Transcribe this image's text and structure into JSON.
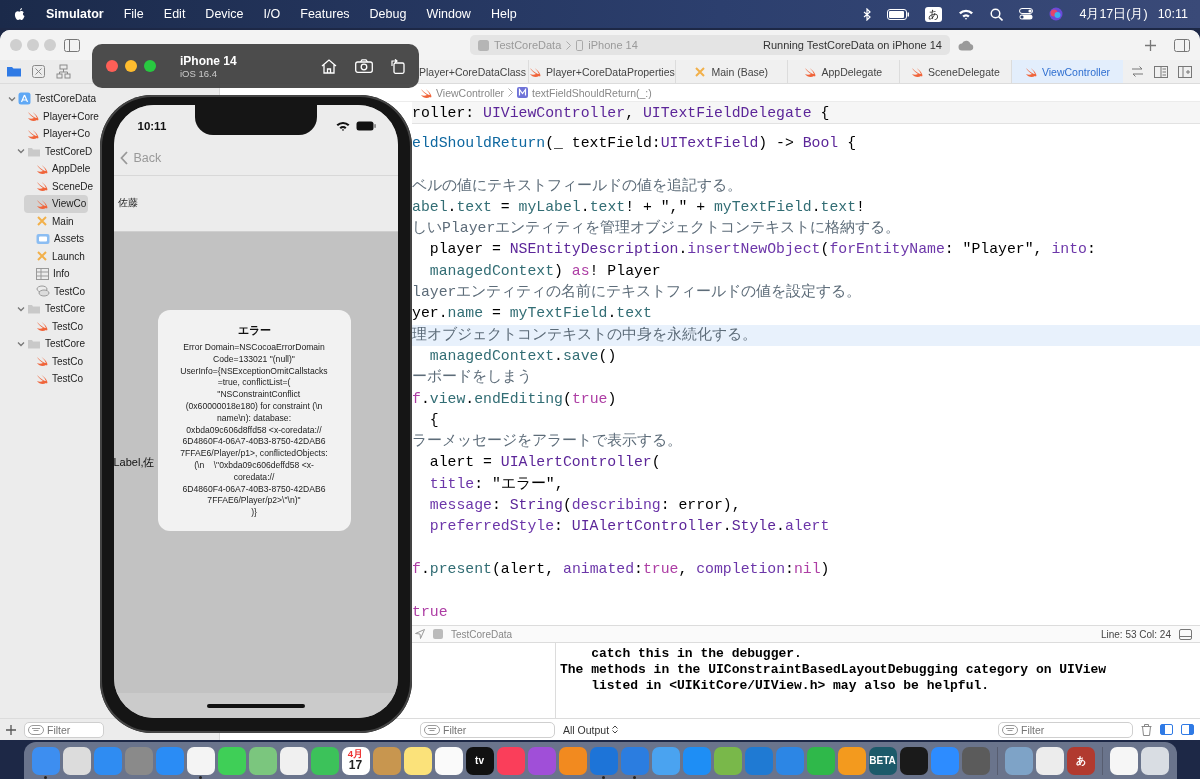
{
  "menu_bar": {
    "app": "Simulator",
    "items": [
      "File",
      "Edit",
      "Device",
      "I/O",
      "Features",
      "Debug",
      "Window",
      "Help"
    ],
    "input_source": "あ",
    "date": "4月17日(月)",
    "time": "10:11"
  },
  "xcode": {
    "activity": {
      "scheme": "TestCoreData",
      "device": "iPhone 14",
      "status": "Running TestCoreData on iPhone 14"
    },
    "navigator_tabs": [
      {
        "selected": true
      },
      {
        "selected": false
      },
      {
        "selected": false
      }
    ],
    "tree": [
      {
        "label": "TestCoreData",
        "kind": "project",
        "expanded": true,
        "selected": false,
        "children": [
          {
            "label": "Player+Core",
            "kind": "swift",
            "selected": false
          },
          {
            "label": "Player+Co",
            "kind": "swift",
            "selected": false
          },
          {
            "label": "TestCoreD",
            "kind": "folder",
            "expanded": true,
            "selected": false,
            "children": [
              {
                "label": "AppDele",
                "kind": "swift",
                "selected": false
              },
              {
                "label": "SceneDe",
                "kind": "swift",
                "selected": false
              },
              {
                "label": "ViewCo",
                "kind": "swift",
                "selected": true
              },
              {
                "label": "Main",
                "kind": "storyboard",
                "selected": false
              },
              {
                "label": "Assets",
                "kind": "assets",
                "selected": false
              },
              {
                "label": "Launch",
                "kind": "storyboard",
                "selected": false
              },
              {
                "label": "Info",
                "kind": "plist",
                "selected": false
              },
              {
                "label": "TestCo",
                "kind": "datamodel",
                "selected": false
              }
            ]
          },
          {
            "label": "TestCore",
            "kind": "folder",
            "expanded": true,
            "selected": false,
            "children": [
              {
                "label": "TestCo",
                "kind": "swift",
                "selected": false
              }
            ]
          },
          {
            "label": "TestCore",
            "kind": "folder",
            "expanded": true,
            "selected": false,
            "children": [
              {
                "label": "TestCo",
                "kind": "swift",
                "selected": false
              },
              {
                "label": "TestCo",
                "kind": "swift",
                "selected": false
              }
            ]
          }
        ]
      }
    ],
    "navigator_filter": {
      "placeholder": "Filter"
    },
    "tabs": [
      {
        "label": "Player+CoreDataClass",
        "selected": false
      },
      {
        "label": "Player+CoreDataProperties",
        "kind": "swift",
        "selected": false
      },
      {
        "label": "Main (Base)",
        "kind": "storyboard",
        "selected": false
      },
      {
        "label": "AppDelegate",
        "kind": "swift",
        "selected": false
      },
      {
        "label": "SceneDelegate",
        "kind": "swift",
        "selected": false
      },
      {
        "label": "ViewController",
        "kind": "swift",
        "selected": true
      }
    ],
    "breadcrumb": [
      {
        "label": "ViewController",
        "kind": "swift"
      },
      {
        "label": "textFieldShouldReturn(_:)",
        "kind": "method"
      }
    ],
    "sticky_header": [
      {
        "text": "roller: ",
        "kind": "plain"
      },
      {
        "text": "UIViewController",
        "kind": "type"
      },
      {
        "text": ", ",
        "kind": "plain"
      },
      {
        "text": "UITextFieldDelegate",
        "kind": "type"
      },
      {
        "text": " {",
        "kind": "plain"
      }
    ],
    "code_lines": [
      {
        "kind": "code",
        "highlighted": false,
        "tokens": [
          {
            "text": "eldShouldReturn",
            "kind": "decl"
          },
          {
            "text": "(_ textField:",
            "kind": "plain"
          },
          {
            "text": "UITextField",
            "kind": "type"
          },
          {
            "text": ") -> ",
            "kind": "plain"
          },
          {
            "text": "Bool",
            "kind": "type"
          },
          {
            "text": " {",
            "kind": "plain"
          }
        ]
      },
      {
        "kind": "blank",
        "highlighted": false
      },
      {
        "kind": "comment",
        "highlighted": false,
        "text": "ベルの値にテキストフィールドの値を追記する。"
      },
      {
        "kind": "code",
        "highlighted": false,
        "tokens": [
          {
            "text": "abel",
            "kind": "member"
          },
          {
            "text": ".",
            "kind": "plain"
          },
          {
            "text": "text",
            "kind": "member"
          },
          {
            "text": " = ",
            "kind": "plain"
          },
          {
            "text": "myLabel",
            "kind": "member"
          },
          {
            "text": ".",
            "kind": "plain"
          },
          {
            "text": "text",
            "kind": "member"
          },
          {
            "text": "! + \",\" + ",
            "kind": "plain"
          },
          {
            "text": "myTextField",
            "kind": "member"
          },
          {
            "text": ".",
            "kind": "plain"
          },
          {
            "text": "text",
            "kind": "member"
          },
          {
            "text": "!",
            "kind": "plain"
          }
        ]
      },
      {
        "kind": "comment",
        "highlighted": false,
        "text": "しいPlayerエンティティを管理オブジェクトコンテキストに格納する。"
      },
      {
        "kind": "code",
        "highlighted": false,
        "tokens": [
          {
            "text": "  player = ",
            "kind": "plain"
          },
          {
            "text": "NSEntityDescription",
            "kind": "type"
          },
          {
            "text": ".",
            "kind": "plain"
          },
          {
            "text": "insertNewObject",
            "kind": "api"
          },
          {
            "text": "(",
            "kind": "plain"
          },
          {
            "text": "forEntityName",
            "kind": "api"
          },
          {
            "text": ": \"Player\", ",
            "kind": "plain"
          },
          {
            "text": "into",
            "kind": "api"
          },
          {
            "text": ":",
            "kind": "plain"
          }
        ]
      },
      {
        "kind": "code",
        "highlighted": false,
        "tokens": [
          {
            "text": "  managedContext",
            "kind": "member"
          },
          {
            "text": ") ",
            "kind": "plain"
          },
          {
            "text": "as",
            "kind": "keyword"
          },
          {
            "text": "! Player",
            "kind": "plain"
          }
        ]
      },
      {
        "kind": "comment",
        "highlighted": false,
        "text": "layerエンティティの名前にテキストフィールドの値を設定する。"
      },
      {
        "kind": "code",
        "highlighted": false,
        "tokens": [
          {
            "text": "yer.",
            "kind": "plain"
          },
          {
            "text": "name",
            "kind": "member"
          },
          {
            "text": " = ",
            "kind": "plain"
          },
          {
            "text": "myTextField",
            "kind": "member"
          },
          {
            "text": ".",
            "kind": "plain"
          },
          {
            "text": "text",
            "kind": "member"
          }
        ]
      },
      {
        "kind": "comment",
        "highlighted": true,
        "text": "理オブジェクトコンテキストの中身を永続化する。"
      },
      {
        "kind": "code",
        "highlighted": false,
        "tokens": [
          {
            "text": "  managedContext",
            "kind": "member"
          },
          {
            "text": ".",
            "kind": "plain"
          },
          {
            "text": "save",
            "kind": "member"
          },
          {
            "text": "()",
            "kind": "plain"
          }
        ]
      },
      {
        "kind": "comment",
        "highlighted": false,
        "text": "ーボードをしまう"
      },
      {
        "kind": "code",
        "highlighted": false,
        "tokens": [
          {
            "text": "f",
            "kind": "keyword"
          },
          {
            "text": ".",
            "kind": "plain"
          },
          {
            "text": "view",
            "kind": "member"
          },
          {
            "text": ".",
            "kind": "plain"
          },
          {
            "text": "endEditing",
            "kind": "member"
          },
          {
            "text": "(",
            "kind": "plain"
          },
          {
            "text": "true",
            "kind": "keyword"
          },
          {
            "text": ")",
            "kind": "plain"
          }
        ]
      },
      {
        "kind": "code",
        "highlighted": false,
        "tokens": [
          {
            "text": "  {",
            "kind": "plain"
          }
        ]
      },
      {
        "kind": "comment",
        "highlighted": false,
        "text": "ラーメッセージをアラートで表示する。"
      },
      {
        "kind": "code",
        "highlighted": false,
        "tokens": [
          {
            "text": "  alert = ",
            "kind": "plain"
          },
          {
            "text": "UIAlertController",
            "kind": "type"
          },
          {
            "text": "(",
            "kind": "plain"
          }
        ]
      },
      {
        "kind": "code",
        "highlighted": false,
        "tokens": [
          {
            "text": "  title",
            "kind": "api"
          },
          {
            "text": ": \"エラー\",",
            "kind": "plain"
          }
        ]
      },
      {
        "kind": "code",
        "highlighted": false,
        "tokens": [
          {
            "text": "  message",
            "kind": "api"
          },
          {
            "text": ": ",
            "kind": "plain"
          },
          {
            "text": "String",
            "kind": "type"
          },
          {
            "text": "(",
            "kind": "plain"
          },
          {
            "text": "describing",
            "kind": "api"
          },
          {
            "text": ": error),",
            "kind": "plain"
          }
        ]
      },
      {
        "kind": "code",
        "highlighted": false,
        "tokens": [
          {
            "text": "  preferredStyle",
            "kind": "api"
          },
          {
            "text": ": ",
            "kind": "plain"
          },
          {
            "text": "UIAlertController",
            "kind": "type"
          },
          {
            "text": ".",
            "kind": "plain"
          },
          {
            "text": "Style",
            "kind": "type"
          },
          {
            "text": ".",
            "kind": "plain"
          },
          {
            "text": "alert",
            "kind": "api"
          }
        ]
      },
      {
        "kind": "blank",
        "highlighted": false
      },
      {
        "kind": "code",
        "highlighted": false,
        "tokens": [
          {
            "text": "f",
            "kind": "keyword"
          },
          {
            "text": ".",
            "kind": "plain"
          },
          {
            "text": "present",
            "kind": "member"
          },
          {
            "text": "(alert, ",
            "kind": "plain"
          },
          {
            "text": "animated",
            "kind": "api"
          },
          {
            "text": ":",
            "kind": "plain"
          },
          {
            "text": "true",
            "kind": "keyword"
          },
          {
            "text": ", ",
            "kind": "plain"
          },
          {
            "text": "completion",
            "kind": "api"
          },
          {
            "text": ":",
            "kind": "plain"
          },
          {
            "text": "nil",
            "kind": "keyword"
          },
          {
            "text": ")",
            "kind": "plain"
          }
        ]
      },
      {
        "kind": "blank",
        "highlighted": false
      },
      {
        "kind": "code",
        "highlighted": false,
        "tokens": [
          {
            "text": "true",
            "kind": "keyword"
          }
        ]
      }
    ],
    "debug_bar": {
      "target": "TestCoreData",
      "position": "Line: 53  Col: 24"
    },
    "console": {
      "output": "    catch this in the debugger.\nThe methods in the UIConstraintBasedLayoutDebugging category on UIView\n    listed in <UIKitCore/UIView.h> may also be helpful."
    },
    "variables_filter": {
      "placeholder": "Filter"
    },
    "output_menu": "All Output",
    "console_filter": {
      "placeholder": "Filter"
    }
  },
  "simulator": {
    "device": "iPhone 14",
    "os": "iOS 16.4",
    "screen": {
      "time": "10:11",
      "back": "Back",
      "cell": "佐藤",
      "label": "Label,佐",
      "alert": {
        "title": "エラー",
        "message": "Error Domain=NSCocoaErrorDomain\nCode=133021 \"(null)\"\nUserInfo={NSExceptionOmitCallstacks\n=true, conflictList=(\n    \"NSConstraintConflict\n(0x60000018e180) for constraint (\\n\nname\\n): database:\n0xbda09c606d8ffd58 <x-coredata://\n6D4860F4-06A7-40B3-8750-42DAB6\n7FFAE6/Player/p1>, conflictedObjects:\n(\\n    \\\"0xbda09c606deffd58 <x-\ncoredata://\n6D4860F4-06A7-40B3-8750-42DAB6\n7FFAE6/Player/p2>\\\"\\n)\"\n)}"
      }
    }
  },
  "dock": [
    {
      "kind": "app",
      "color": "#3d8ef0",
      "running": true
    },
    {
      "kind": "app",
      "color": "#dcdcdc",
      "running": false
    },
    {
      "kind": "app",
      "color": "#2f8cf2",
      "running": false
    },
    {
      "kind": "app",
      "color": "#8a8a8a",
      "running": false
    },
    {
      "kind": "app",
      "color": "#2a8cf5",
      "running": false
    },
    {
      "kind": "app",
      "color": "#f4f4f4",
      "running": true
    },
    {
      "kind": "app",
      "color": "#3fcf57",
      "running": false
    },
    {
      "kind": "app",
      "color": "#7bc67e",
      "running": false
    },
    {
      "kind": "app",
      "color": "#f0f0f0",
      "running": false
    },
    {
      "kind": "app",
      "color": "#3cc25a",
      "running": false
    },
    {
      "kind": "app",
      "color": "#ffffff",
      "running": false,
      "header": "4月",
      "label": "17"
    },
    {
      "kind": "app",
      "color": "#c8964f",
      "running": false
    },
    {
      "kind": "app",
      "color": "#fbe27a",
      "running": false
    },
    {
      "kind": "app",
      "color": "#fafafa",
      "running": false
    },
    {
      "kind": "app",
      "color": "#111111",
      "running": false,
      "label": "tv"
    },
    {
      "kind": "app",
      "color": "#fa3e5a",
      "running": false
    },
    {
      "kind": "app",
      "color": "#a04fd8",
      "running": false
    },
    {
      "kind": "app",
      "color": "#f28a1f",
      "running": false
    },
    {
      "kind": "app",
      "color": "#1d74d8",
      "running": true
    },
    {
      "kind": "app",
      "color": "#2b7de0",
      "running": true
    },
    {
      "kind": "app",
      "color": "#4aa3f0",
      "running": false
    },
    {
      "kind": "app",
      "color": "#1e8ef5",
      "running": false
    },
    {
      "kind": "app",
      "color": "#79b84a",
      "running": false
    },
    {
      "kind": "app",
      "color": "#1f7ad3",
      "running": false
    },
    {
      "kind": "app",
      "color": "#2c86e5",
      "running": false
    },
    {
      "kind": "app",
      "color": "#2fb84a",
      "running": false
    },
    {
      "kind": "app",
      "color": "#f39a1e",
      "running": false
    },
    {
      "kind": "app",
      "color": "#1c5a6a",
      "running": false,
      "label": "BETA"
    },
    {
      "kind": "app",
      "color": "#1a1a1a",
      "running": false
    },
    {
      "kind": "app",
      "color": "#2d8cff",
      "running": false
    },
    {
      "kind": "app",
      "color": "#5b5b5b",
      "running": false
    },
    {
      "kind": "separator"
    },
    {
      "kind": "app",
      "color": "#7ea3c7",
      "running": false
    },
    {
      "kind": "app",
      "color": "#ececec",
      "running": false
    },
    {
      "kind": "app",
      "color": "#b13a2f",
      "running": false,
      "label": "あ"
    },
    {
      "kind": "separator"
    },
    {
      "kind": "app",
      "color": "#f6f6f6",
      "running": false
    },
    {
      "kind": "app",
      "color": "#d9dde3",
      "running": false
    }
  ]
}
